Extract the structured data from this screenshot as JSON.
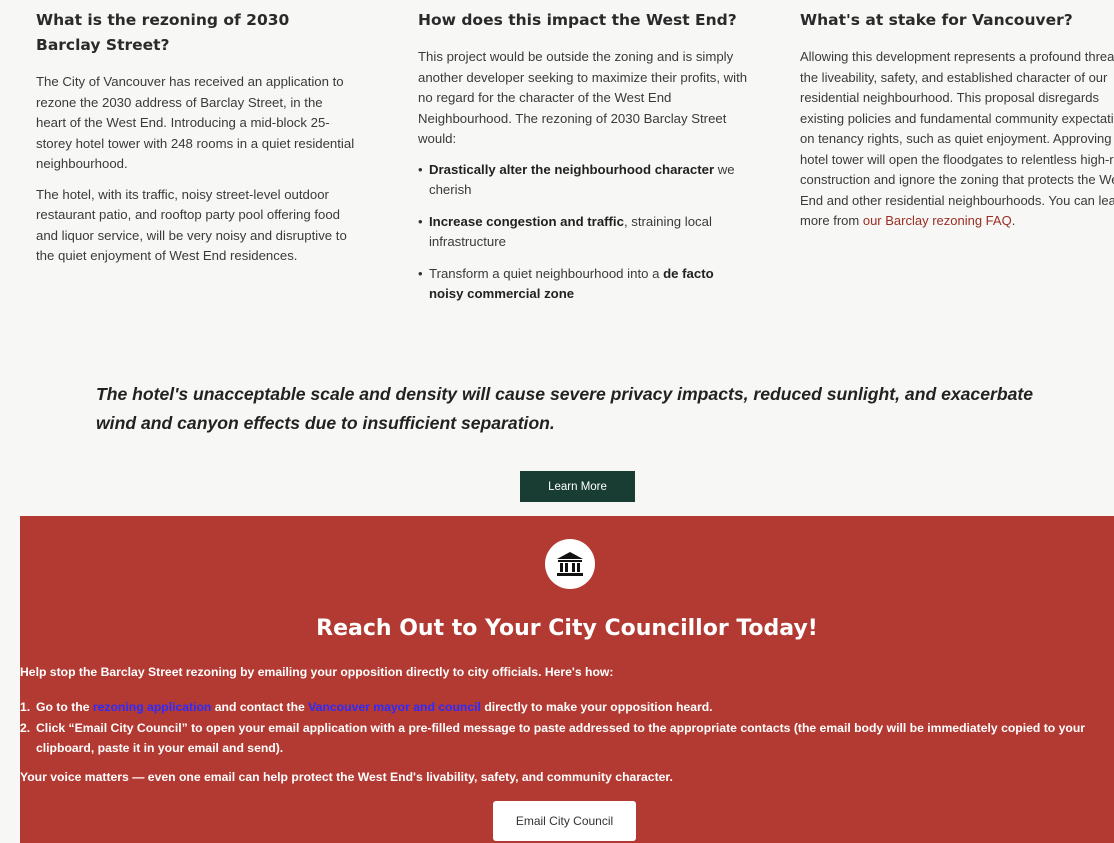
{
  "columns": {
    "col1": {
      "heading": "What is the rezoning of 2030 Barclay Street?",
      "p1": "The City of Vancouver has received an application to rezone the 2030 address of Barclay Street, in the heart of the West End. Introducing a mid-block 25-storey hotel tower with 248 rooms in a quiet residential neighbourhood.",
      "p2": "The hotel, with its traffic, noisy street-level outdoor restaurant patio, and rooftop party pool offering food and liquor service, will be very noisy and disruptive to the quiet enjoyment of West End residences."
    },
    "col2": {
      "heading": "How does this impact the West End?",
      "p1": "This project would be outside the zoning and is simply another developer seeking to maximize their profits, with no regard for the character of the West End Neighbourhood. The rezoning of 2030 Barclay Street would:",
      "bullets": [
        {
          "bold": "Drastically alter the neighbourhood character",
          "rest": " we cherish"
        },
        {
          "bold": "Increase congestion and traffic",
          "rest": ", straining local infrastructure"
        },
        {
          "pre": "Transform a quiet neighbourhood into a ",
          "bold": "de facto noisy commercial zone"
        }
      ]
    },
    "col3": {
      "heading": "What's at stake for Vancouver?",
      "p1": "Allowing this development represents a profound threat to the liveability, safety, and established character of our residential neighbourhood.  This proposal disregards existing policies and fundamental community expectations on tenancy rights, such as quiet enjoyment. Approving this hotel tower will open the floodgates to relentless high-rise construction and ignore the zoning that protects the West End and other residential neighbourhoods. You can learn more from ",
      "link": "our Barclay rezoning FAQ",
      "tail": "."
    }
  },
  "callout": "The hotel's unacceptable scale and density will cause severe privacy impacts, reduced sunlight, and exacerbate wind and canyon effects due to insufficient separation.",
  "learn_more_label": "Learn More",
  "cta": {
    "icon": "government-building-icon",
    "title": "Reach Out to Your City Councillor Today!",
    "intro": "Help stop the Barclay Street rezoning by emailing your opposition directly to city officials. Here's how:",
    "step1": {
      "num": "1.",
      "pre": "Go to the ",
      "link1": "rezoning application",
      "mid": " and contact the ",
      "link2": "Vancouver mayor and council",
      "post": " directly to make your opposition heard."
    },
    "step2": {
      "num": "2.",
      "bold": "Click “Email City Council”",
      "rest": " to open your email application with a pre-filled message to paste addressed to the appropriate contacts (the email body will be immediately copied to your clipboard, paste it in your email and send)."
    },
    "voice_bold": "Your voice matters",
    "voice_rest": " — even one email can help protect the West End's livability, safety, and community character.",
    "button_label": "Email City Council"
  },
  "colors": {
    "cta_bg": "#b33a32",
    "learn_btn": "#193d33",
    "link_blue": "#2b2bff",
    "faq_link": "#9b2d24"
  }
}
